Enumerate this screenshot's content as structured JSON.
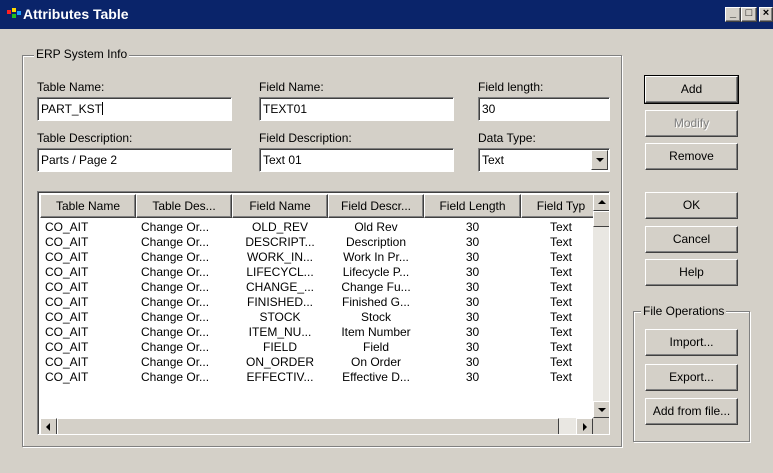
{
  "window": {
    "title": "Attributes Table",
    "minimize_glyph": "_",
    "maximize_glyph": "□",
    "close_glyph": "×"
  },
  "erp_group": {
    "label": "ERP System Info"
  },
  "form": {
    "table_name_label": "Table Name:",
    "table_name_value": "PART_KST",
    "field_name_label": "Field Name:",
    "field_name_value": "TEXT01",
    "field_length_label": "Field length:",
    "field_length_value": "30",
    "table_description_label": "Table Description:",
    "table_description_value": "Parts / Page 2",
    "field_description_label": "Field Description:",
    "field_description_value": "Text 01",
    "data_type_label": "Data Type:",
    "data_type_value": "Text"
  },
  "buttons": {
    "add": "Add",
    "modify": "Modify",
    "remove": "Remove",
    "ok": "OK",
    "cancel": "Cancel",
    "help": "Help",
    "import": "Import...",
    "export": "Export...",
    "add_from_file": "Add from file..."
  },
  "file_ops_group": {
    "label": "File Operations"
  },
  "table": {
    "columns": [
      "Table Name",
      "Table Des...",
      "Field Name",
      "Field Descr...",
      "Field Length",
      "Field Typ"
    ],
    "rows": [
      [
        "CO_AIT",
        "Change Or...",
        "OLD_REV",
        "Old Rev",
        "30",
        "Text"
      ],
      [
        "CO_AIT",
        "Change Or...",
        "DESCRIPT...",
        "Description",
        "30",
        "Text"
      ],
      [
        "CO_AIT",
        "Change Or...",
        "WORK_IN...",
        "Work In Pr...",
        "30",
        "Text"
      ],
      [
        "CO_AIT",
        "Change Or...",
        "LIFECYCL...",
        "Lifecycle P...",
        "30",
        "Text"
      ],
      [
        "CO_AIT",
        "Change Or...",
        "CHANGE_...",
        "Change Fu...",
        "30",
        "Text"
      ],
      [
        "CO_AIT",
        "Change Or...",
        "FINISHED...",
        "Finished G...",
        "30",
        "Text"
      ],
      [
        "CO_AIT",
        "Change Or...",
        "STOCK",
        "Stock",
        "30",
        "Text"
      ],
      [
        "CO_AIT",
        "Change Or...",
        "ITEM_NU...",
        "Item Number",
        "30",
        "Text"
      ],
      [
        "CO_AIT",
        "Change Or...",
        "FIELD",
        "Field",
        "30",
        "Text"
      ],
      [
        "CO_AIT",
        "Change Or...",
        "ON_ORDER",
        "On Order",
        "30",
        "Text"
      ],
      [
        "CO_AIT",
        "Change Or...",
        "EFFECTIV...",
        "Effective D...",
        "30",
        "Text"
      ]
    ]
  }
}
